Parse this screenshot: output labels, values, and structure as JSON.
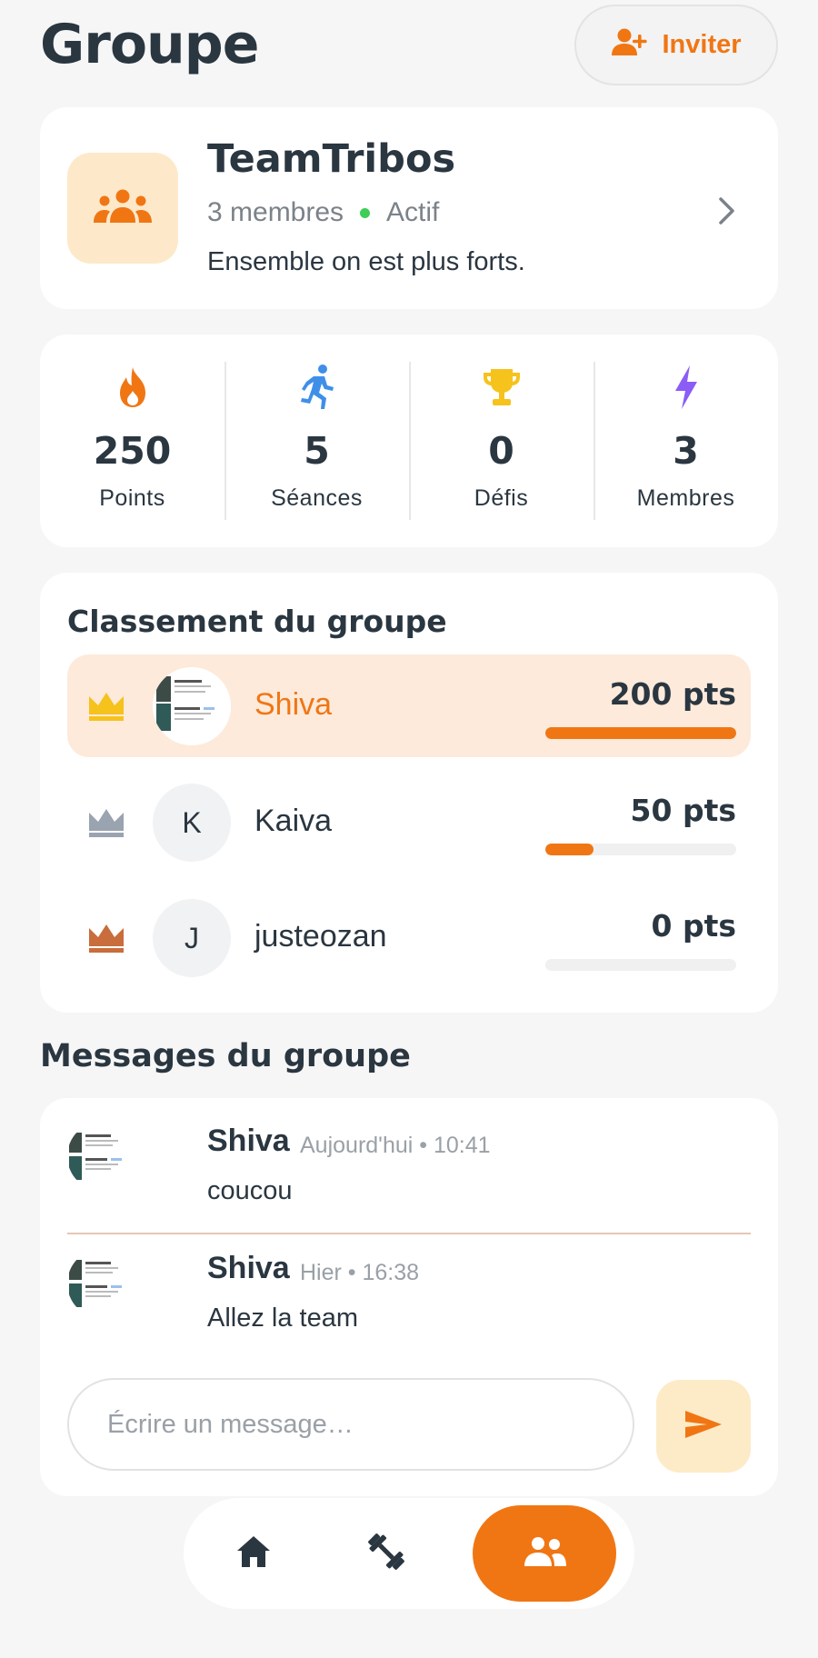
{
  "header": {
    "title": "Groupe",
    "invite_label": "Inviter"
  },
  "group": {
    "name": "TeamTribos",
    "members_text": "3 membres",
    "status": "Actif",
    "description": "Ensemble on est plus forts."
  },
  "stats": [
    {
      "icon": "fire-icon",
      "value": "250",
      "label": "Points",
      "color": "#f07614"
    },
    {
      "icon": "running-icon",
      "value": "5",
      "label": "Séances",
      "color": "#3f8fe8"
    },
    {
      "icon": "trophy-icon",
      "value": "0",
      "label": "Défis",
      "color": "#f6c21c"
    },
    {
      "icon": "lightning-icon",
      "value": "3",
      "label": "Membres",
      "color": "#8b5cf6"
    }
  ],
  "leaderboard": {
    "title": "Classement du groupe",
    "entries": [
      {
        "name": "Shiva",
        "points_label": "200 pts",
        "points": 200,
        "initial": "",
        "crown": "gold",
        "progress": 1.0
      },
      {
        "name": "Kaiva",
        "points_label": "50 pts",
        "points": 50,
        "initial": "K",
        "crown": "silver",
        "progress": 0.25
      },
      {
        "name": "justeozan",
        "points_label": "0 pts",
        "points": 0,
        "initial": "J",
        "crown": "bronze",
        "progress": 0
      }
    ]
  },
  "messages": {
    "title": "Messages du groupe",
    "items": [
      {
        "author": "Shiva",
        "time": "Aujourd'hui • 10:41",
        "text": "coucou"
      },
      {
        "author": "Shiva",
        "time": "Hier • 16:38",
        "text": "Allez la team"
      }
    ],
    "composer_placeholder": "Écrire un message…"
  },
  "nav": {
    "items": [
      {
        "icon": "home-icon",
        "active": false
      },
      {
        "icon": "dumbbell-icon",
        "active": false
      },
      {
        "icon": "group-icon",
        "active": true
      }
    ]
  },
  "colors": {
    "accent": "#f07614",
    "text": "#2a3640",
    "crown_gold": "#f6c21c",
    "crown_silver": "#9aa3b0",
    "crown_bronze": "#c96d3c"
  }
}
